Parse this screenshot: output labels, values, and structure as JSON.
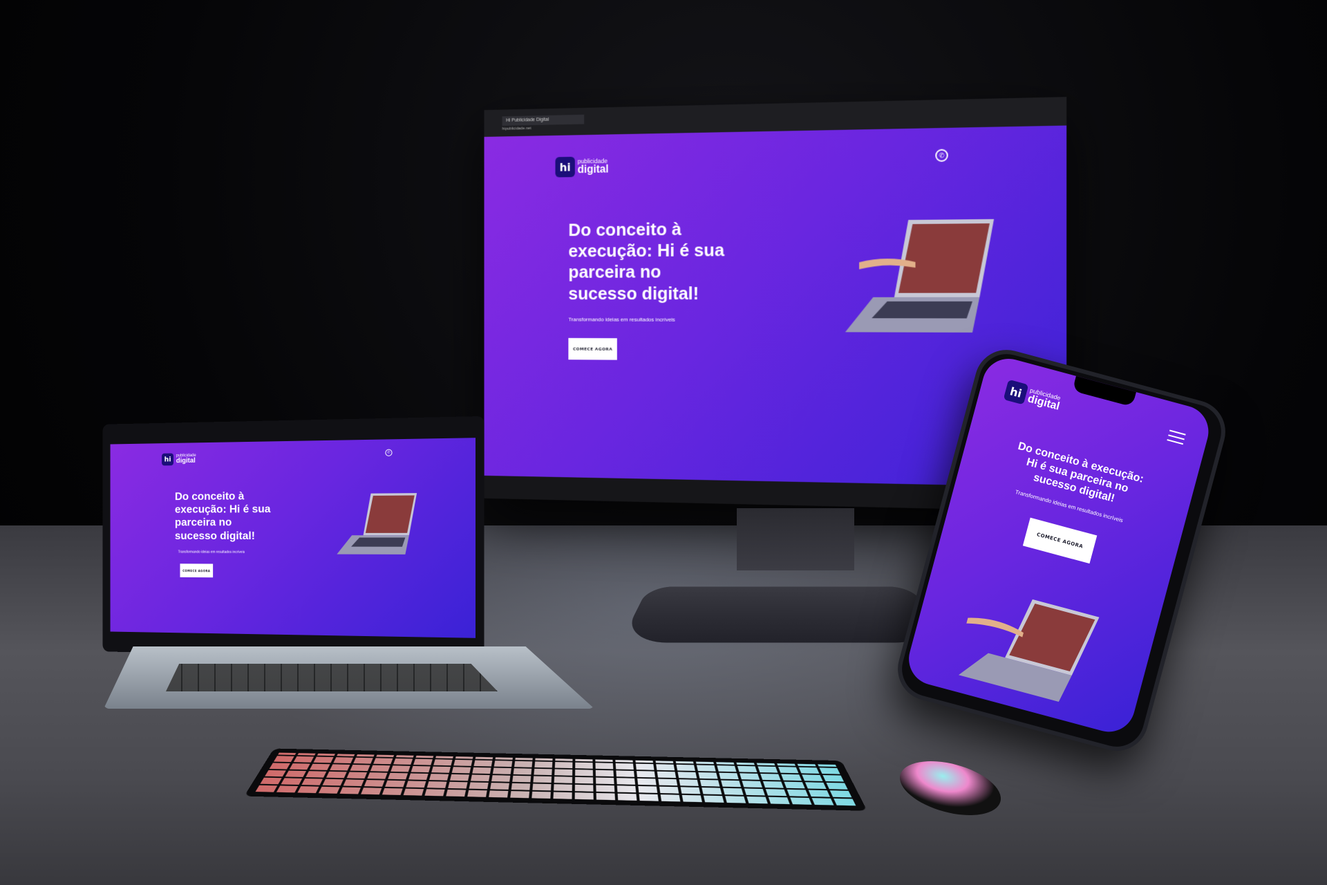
{
  "brand": {
    "mark": "hi",
    "small": "publicidade",
    "big": "digital"
  },
  "hero": {
    "headline_line1": "Do conceito à",
    "headline_line2": "execução: Hi é sua",
    "headline_line3": "parceira no",
    "headline_line4": "sucesso digital!",
    "phone_headline_1": "Do conceito à execução:",
    "phone_headline_2": "Hi é sua parceira no",
    "phone_headline_3": "sucesso digital!",
    "subtitle": "Transformando ideias em resultados incríveis",
    "cta": "COMECE AGORA"
  },
  "browser": {
    "tab_title": "Hi Publicidade Digital",
    "menu_label": "Menu",
    "url": "hipublicidade.net"
  },
  "icons": {
    "whatsapp": "whatsapp-icon",
    "menu": "hamburger-menu-icon"
  },
  "colors": {
    "gradient_start": "#8a2be2",
    "gradient_end": "#3a22d6",
    "brand_badge": "#1b0e7a",
    "cta_bg": "#ffffff"
  }
}
